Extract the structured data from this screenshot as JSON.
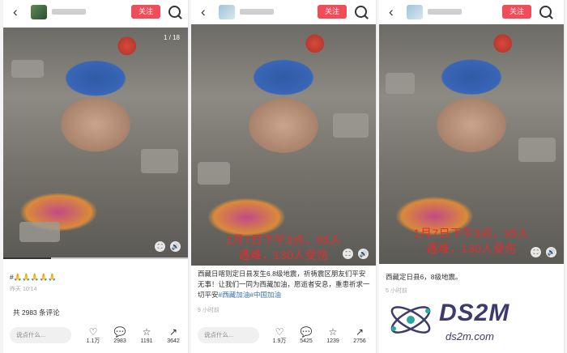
{
  "panels": [
    {
      "follow_label": "关注",
      "counter": "1 / 18",
      "caption": "#🙏🙏🙏🙏🙏",
      "time": "昨天 10:14",
      "comment_count": "共 2983 条评论",
      "comment_placeholder": "说点什么...",
      "actions": [
        {
          "icon": "heart-icon",
          "glyph": "♡",
          "count": "1.1万"
        },
        {
          "icon": "comment-icon",
          "glyph": "💬",
          "count": "2983"
        },
        {
          "icon": "star-icon",
          "glyph": "☆",
          "count": "1191"
        },
        {
          "icon": "share-icon",
          "glyph": "↗",
          "count": "3642"
        }
      ],
      "progress": 0.26
    },
    {
      "follow_label": "关注",
      "overlay_line1": "1月7日下午3点，95人",
      "overlay_line2": "遇难，130人受伤",
      "caption_text": "西藏日喀则定日县发生6.8级地震，祈祷震区朋友们平安无事！让我们一同为西藏加油，愿逝者安息，重患祈求一切平安",
      "caption_tags": "#西藏加油#中国加油",
      "time": "9 小时前",
      "comment_placeholder": "说点什么...",
      "actions": [
        {
          "icon": "heart-icon",
          "glyph": "♡",
          "count": "1.9万"
        },
        {
          "icon": "comment-icon",
          "glyph": "💬",
          "count": "5425"
        },
        {
          "icon": "star-icon",
          "glyph": "☆",
          "count": "1239"
        },
        {
          "icon": "share-icon",
          "glyph": "↗",
          "count": "2756"
        }
      ],
      "progress": 0.6
    },
    {
      "follow_label": "关注",
      "overlay_line1": "1月7日下午3点，95人",
      "overlay_line2": "遇难，130人受伤",
      "caption_text": "西藏定日县6，8级地震。",
      "time": "5 小时前",
      "progress": 0.55
    }
  ],
  "watermark": {
    "title": "DS2M",
    "url": "ds2m.com"
  }
}
